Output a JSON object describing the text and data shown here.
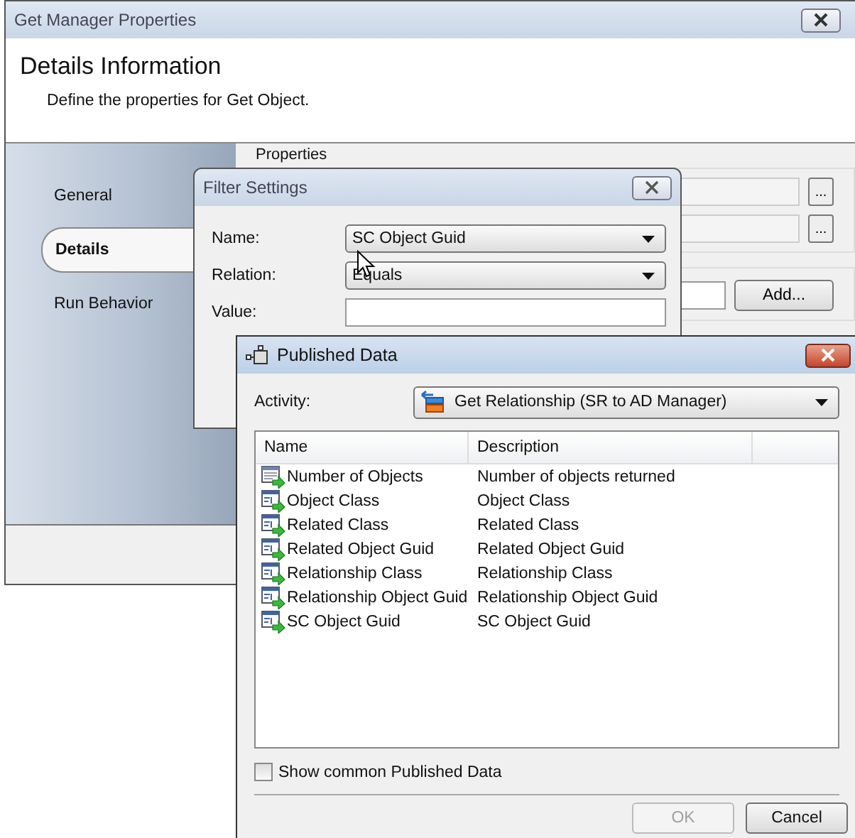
{
  "main_window": {
    "title": "Get Manager Properties",
    "header_title": "Details Information",
    "header_subtitle": "Define the properties for Get Object.",
    "nav": [
      {
        "label": "General",
        "selected": false
      },
      {
        "label": "Details",
        "selected": true
      },
      {
        "label": "Run Behavior",
        "selected": false
      }
    ],
    "properties_label": "Properties",
    "browse_buttons": [
      "...",
      "..."
    ],
    "add_button": "Add..."
  },
  "filter_dialog": {
    "title": "Filter Settings",
    "fields": [
      {
        "label": "Name:",
        "kind": "dropdown",
        "value": "SC Object Guid"
      },
      {
        "label": "Relation:",
        "kind": "dropdown",
        "value": "Equals"
      },
      {
        "label": "Value:",
        "kind": "text"
      }
    ]
  },
  "published_dialog": {
    "title": "Published Data",
    "activity_label": "Activity:",
    "activity": "Get Relationship (SR to AD Manager)",
    "columns": [
      "Name",
      "Description"
    ],
    "rows": [
      {
        "name": "Number of Objects",
        "description": "Number of objects returned",
        "kind": "number"
      },
      {
        "name": "Object Class",
        "description": "Object Class",
        "kind": "text"
      },
      {
        "name": "Related Class",
        "description": "Related Class",
        "kind": "text"
      },
      {
        "name": "Related Object Guid",
        "description": "Related Object Guid",
        "kind": "text"
      },
      {
        "name": "Relationship Class",
        "description": "Relationship Class",
        "kind": "text"
      },
      {
        "name": "Relationship Object Guid",
        "description": "Relationship Object Guid",
        "kind": "text"
      },
      {
        "name": "SC Object Guid",
        "description": "SC Object Guid",
        "kind": "text"
      }
    ],
    "show_common": {
      "label": "Show common Published Data",
      "checked": false
    },
    "buttons": [
      {
        "label": "OK",
        "disabled": true
      },
      {
        "label": "Cancel",
        "disabled": false
      }
    ]
  }
}
